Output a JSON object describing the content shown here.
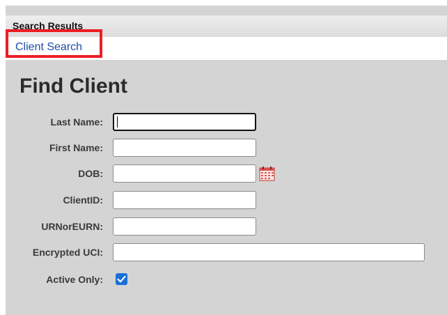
{
  "panel": {
    "title": "Search Results"
  },
  "link_bar": {
    "client_search_link": "Client Search"
  },
  "form": {
    "heading": "Find Client",
    "fields": [
      {
        "label": "Last Name:",
        "value": ""
      },
      {
        "label": "First Name:",
        "value": ""
      },
      {
        "label": "DOB:",
        "value": ""
      },
      {
        "label": "ClientID:",
        "value": ""
      },
      {
        "label": "URNorEURN:",
        "value": ""
      },
      {
        "label": "Encrypted UCI:",
        "value": ""
      }
    ],
    "active_only": {
      "label": "Active Only:",
      "checked": true
    }
  },
  "colors": {
    "highlight": "#ee1c24",
    "link": "#1e4ba8",
    "checkbox": "#1a6fd6",
    "panel_bg": "#d4d4d4"
  },
  "icons": [
    "calendar-icon",
    "checkmark-icon"
  ]
}
